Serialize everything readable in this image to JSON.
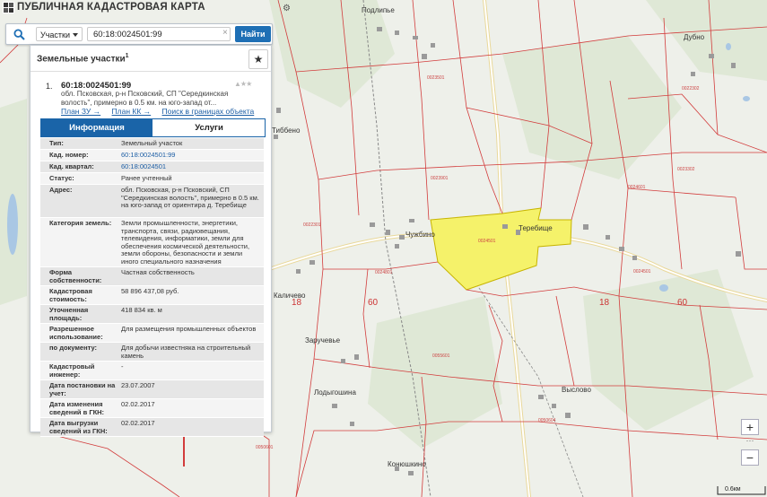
{
  "app": {
    "title": "ПУБЛИЧНАЯ КАДАСТРОВАЯ КАРТА"
  },
  "search": {
    "category": "Участки",
    "query": "60:18:0024501:99",
    "clear": "×",
    "button": "Найти"
  },
  "panel": {
    "title": "Земельные участки",
    "title_sup": "1",
    "result": {
      "index": "1.",
      "id": "60:18:0024501:99",
      "address": "обл. Псковская, р-н Псковский, СП \"Середкинская волость\", примерно в 0.5 км. на юго-запад от...",
      "links": [
        "План ЗУ →",
        "План КК →",
        "Поиск в границах объекта →"
      ]
    },
    "tabs": [
      "Информация",
      "Услуги"
    ],
    "rows": [
      {
        "k": "Тип:",
        "v": "Земельный участок",
        "h": 12
      },
      {
        "k": "Кад. номер:",
        "v": "60:18:0024501:99",
        "link": true,
        "h": 12
      },
      {
        "k": "Кад. квартал:",
        "v": "60:18:0024501",
        "link": true,
        "h": 12
      },
      {
        "k": "Статус:",
        "v": "Ранее учтенный",
        "h": 12
      },
      {
        "k": "Адрес:",
        "v": "обл. Псковская, р-н Псковский, СП \"Середкинская волость\", примерно в 0.5 км. на юго-запад от ориентира д. Теребище",
        "h": 36
      },
      {
        "k": "Категория земель:",
        "v": "Земли промышленности, энергетики, транспорта, связи, радиовещания, телевидения, информатики, земли для обеспечения космической деятельности, земли обороны, безопасности и земли иного специального назначения",
        "h": 54
      },
      {
        "k": "Форма собственности:",
        "v": "Частная собственность",
        "h": 20
      },
      {
        "k": "Кадастровая стоимость:",
        "v": "58 896 437,08 руб.",
        "h": 20
      },
      {
        "k": "Уточненная площадь:",
        "v": "418 834 кв. м",
        "h": 20
      },
      {
        "k": "Разрешенное использование:",
        "v": "Для размещения промышленных объектов",
        "h": 20
      },
      {
        "k": "по документу:",
        "v": "Для добычи известняка на строительный камень",
        "h": 20
      },
      {
        "k": "Кадастровый инженер:",
        "v": "-",
        "h": 20
      },
      {
        "k": "Дата постановки на учет:",
        "v": "23.07.2007",
        "h": 20
      },
      {
        "k": "Дата изменения сведений в ГКН:",
        "v": "02.02.2017",
        "h": 20
      },
      {
        "k": "Дата выгрузки сведений из ГКН:",
        "v": "02.02.2017",
        "h": 20
      }
    ]
  },
  "map": {
    "places": [
      "Подлипье",
      "Дубно",
      "Тиббено",
      "Чужбино",
      "Теребище",
      "Каличево",
      "Заручевье",
      "Лодыгошина",
      "Выслово",
      "Конюшкино"
    ],
    "region_numbers": [
      "60",
      "60",
      "18",
      "18"
    ],
    "parcel_labels": [
      "0024501",
      "0024801",
      "0023901",
      "0024501",
      "0024601",
      "0022301",
      "0055601",
      "0050601",
      "0050604",
      "0023501",
      "0023302",
      "0022302"
    ],
    "scale": "0.6км",
    "colors": {
      "selected_parcel": "#f5f26a",
      "boundary": "#d23c3c",
      "accent": "#1a64a8"
    }
  },
  "zoom": {
    "in": "+",
    "out": "−",
    "dots": "···"
  }
}
